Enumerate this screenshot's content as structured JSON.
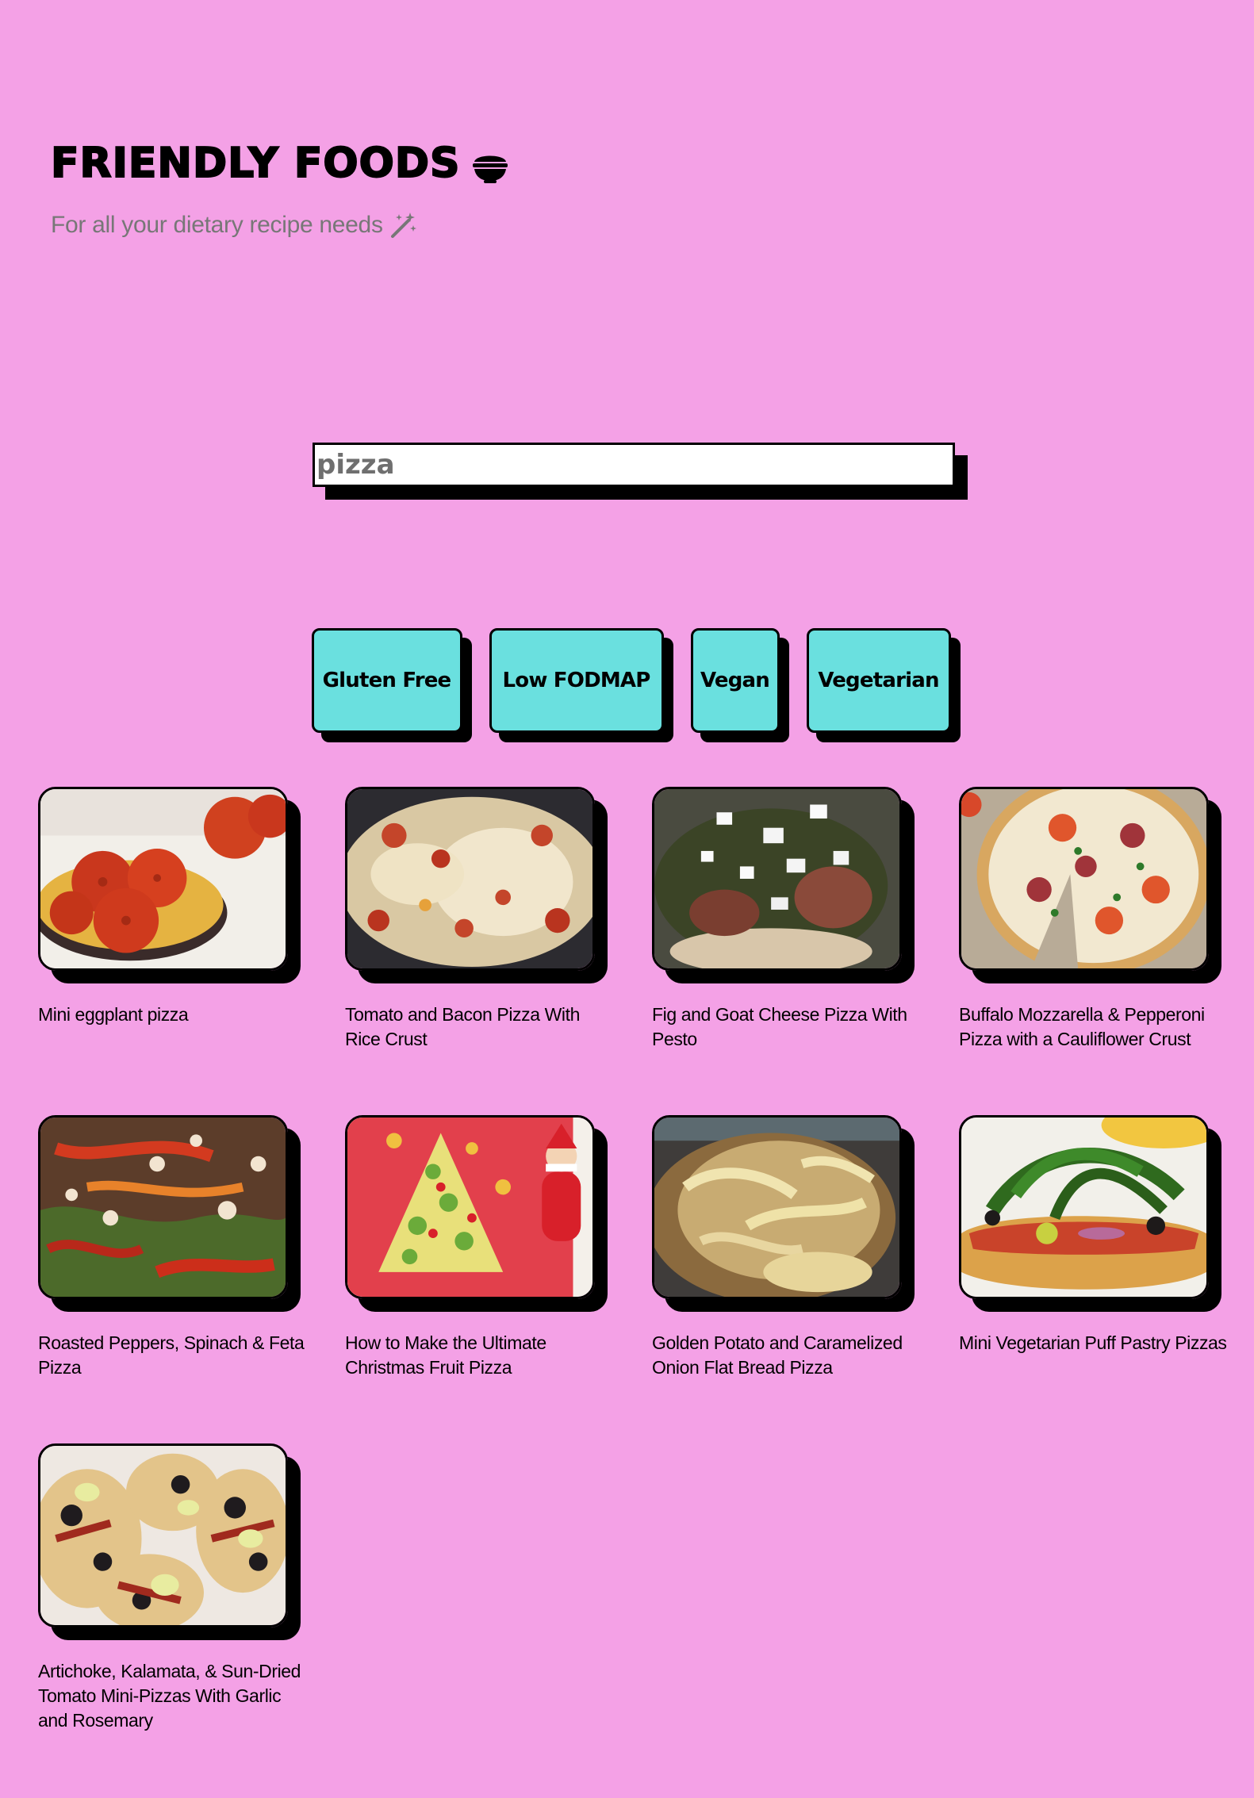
{
  "header": {
    "title": "FRIENDLY FOODS",
    "title_icon": "bowl-icon",
    "subtitle": "For all your dietary recipe needs",
    "subtitle_icon": "magic-wand-icon"
  },
  "search": {
    "value": "pizza",
    "placeholder": ""
  },
  "filters": [
    {
      "label": "Gluten Free"
    },
    {
      "label": "Low FODMAP"
    },
    {
      "label": "Vegan"
    },
    {
      "label": "Vegetarian"
    }
  ],
  "recipes": [
    {
      "title": "Mini eggplant pizza"
    },
    {
      "title": "Tomato and Bacon Pizza With Rice Crust"
    },
    {
      "title": "Fig and Goat Cheese Pizza With Pesto"
    },
    {
      "title": "Buffalo Mozzarella & Pepperoni Pizza with a Cauliflower Crust"
    },
    {
      "title": "Roasted Peppers, Spinach & Feta Pizza"
    },
    {
      "title": "How to Make the Ultimate Christmas Fruit Pizza"
    },
    {
      "title": "Golden Potato and Caramelized Onion Flat Bread Pizza"
    },
    {
      "title": "Mini Vegetarian Puff Pastry Pizzas"
    },
    {
      "title": "Artichoke, Kalamata, & Sun-Dried Tomato Mini-Pizzas With Garlic and Rosemary"
    }
  ],
  "colors": {
    "background": "#f4a1e6",
    "button": "#6ae0df",
    "shadow": "#000000",
    "subtitle": "#777777"
  }
}
